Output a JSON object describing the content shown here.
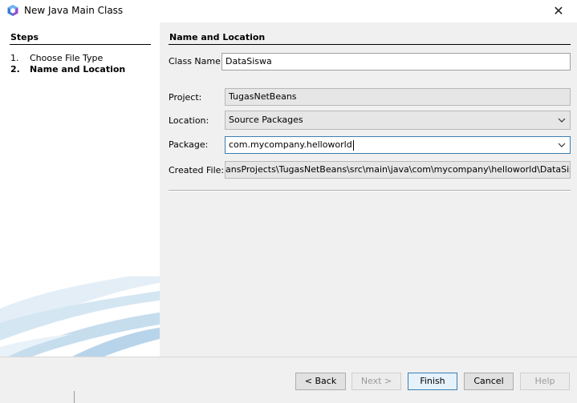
{
  "window": {
    "title": "New Java Main Class",
    "close_glyph": "✕"
  },
  "steps": {
    "title": "Steps",
    "items": [
      {
        "num": "1.",
        "label": "Choose File Type",
        "active": false
      },
      {
        "num": "2.",
        "label": "Name and Location",
        "active": true
      }
    ]
  },
  "panel": {
    "title": "Name and Location",
    "class_name_label": "Class Name:",
    "class_name_value": "DataSiswa",
    "project_label": "Project:",
    "project_value": "TugasNetBeans",
    "location_label": "Location:",
    "location_value": "Source Packages",
    "package_label": "Package:",
    "package_value": "com.mycompany.helloworld",
    "created_file_label": "Created File:",
    "created_file_value": "ansProjects\\TugasNetBeans\\src\\main\\java\\com\\mycompany\\helloworld\\DataSiswa.java"
  },
  "buttons": {
    "back": "< Back",
    "next": "Next >",
    "finish": "Finish",
    "cancel": "Cancel",
    "help": "Help"
  },
  "colors": {
    "focus_border": "#3c7fb1",
    "default_button_bg": "#e5f1fb",
    "app_icon_primary": "#3a7bd5",
    "app_icon_secondary": "#9b4dca"
  },
  "icons": {
    "app": "netbeans-cube-icon",
    "close": "close-icon",
    "dropdown": "chevron-down-icon"
  }
}
